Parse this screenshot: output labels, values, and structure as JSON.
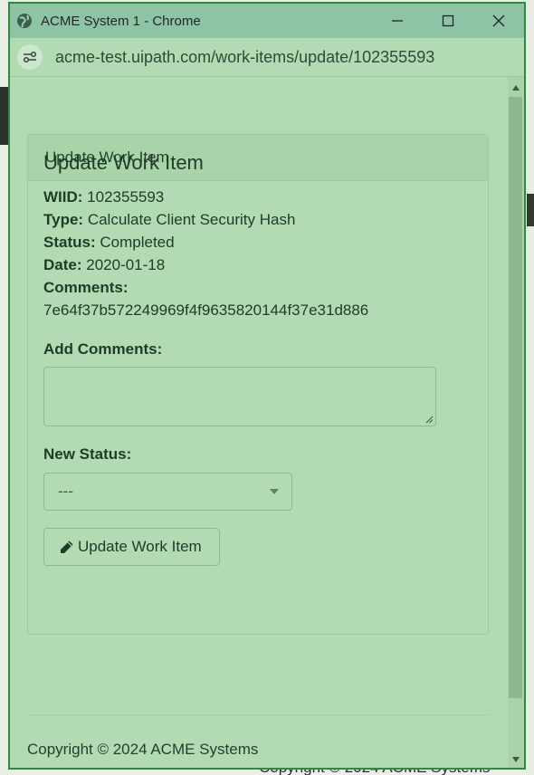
{
  "background": {
    "footer_text": "Copyright © 2024 ACME Systems"
  },
  "window": {
    "title": "ACME System 1 - Chrome",
    "url": "acme-test.uipath.com/work-items/update/102355593"
  },
  "panel": {
    "heading": "Update Work Item"
  },
  "work_item": {
    "title": "Update Work Item",
    "wiid_label": "WIID:",
    "wiid_value": "102355593",
    "type_label": "Type:",
    "type_value": "Calculate Client Security Hash",
    "status_label": "Status:",
    "status_value": "Completed",
    "date_label": "Date:",
    "date_value": "2020-01-18",
    "comments_label": "Comments:",
    "comments_value": "7e64f37b572249969f4f9635820144f37e31d886"
  },
  "form": {
    "add_comments_label": "Add Comments:",
    "add_comments_value": "",
    "new_status_label": "New Status:",
    "new_status_selected": "---",
    "submit_label": "Update Work Item"
  },
  "footer": {
    "text": "Copyright © 2024 ACME Systems"
  }
}
